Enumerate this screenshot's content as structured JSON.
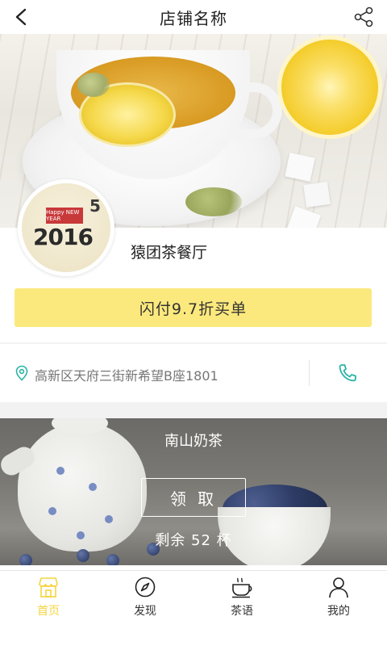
{
  "header": {
    "title": "店铺名称"
  },
  "shop": {
    "name": "猿团茶餐厅",
    "avatar_text": {
      "ribbon": "Happy NEW YEAR",
      "year": "2016",
      "five": "5"
    }
  },
  "pay": {
    "label": "闪付9.7折买单"
  },
  "address": {
    "text": "高新区天府三街新希望B座1801"
  },
  "promo": {
    "title": "南山奶茶",
    "claim_label": "领 取",
    "remaining": "剩余 52 杯"
  },
  "tabs": [
    {
      "label": "首页",
      "icon": "storefront-icon",
      "active": true
    },
    {
      "label": "发现",
      "icon": "compass-icon",
      "active": false
    },
    {
      "label": "茶语",
      "icon": "teacup-icon",
      "active": false
    },
    {
      "label": "我的",
      "icon": "person-icon",
      "active": false
    }
  ],
  "colors": {
    "accent": "#fce97d",
    "active_tab": "#f4d53e",
    "address_icon": "#2bb3a6"
  }
}
